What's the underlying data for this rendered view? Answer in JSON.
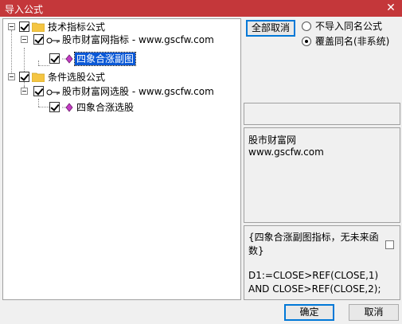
{
  "window": {
    "title": "导入公式",
    "close_glyph": "✕"
  },
  "tree": {
    "nodes": [
      {
        "label": "技术指标公式",
        "checked": true
      },
      {
        "label": "股市财富网指标 - www.gscfw.com",
        "checked": true
      },
      {
        "label": "四象合涨副图",
        "checked": true,
        "selected": true
      },
      {
        "label": "条件选股公式",
        "checked": true
      },
      {
        "label": "股市财富网选股 - www.gscfw.com",
        "checked": true
      },
      {
        "label": "四象合涨选股",
        "checked": true
      }
    ]
  },
  "options": {
    "cancel_all_label": "全部取消",
    "radio_no_import": "不导入同名公式",
    "radio_overwrite": "覆盖同名(非系统)",
    "selected": "overwrite"
  },
  "description": {
    "line1": "股市财富网",
    "line2": "www.gscfw.com"
  },
  "code": {
    "line1": "{四象合涨副图指标，无未来函",
    "line2": "数}",
    "line3": "D1:=CLOSE>REF(CLOSE,1)",
    "line4": "AND CLOSE>REF(CLOSE,2);"
  },
  "footer": {
    "ok_label": "确定",
    "cancel_label": "取消"
  },
  "colors": {
    "titlebar": "#c4373a",
    "selection": "#0a58d6",
    "folder": "#f5c542"
  }
}
